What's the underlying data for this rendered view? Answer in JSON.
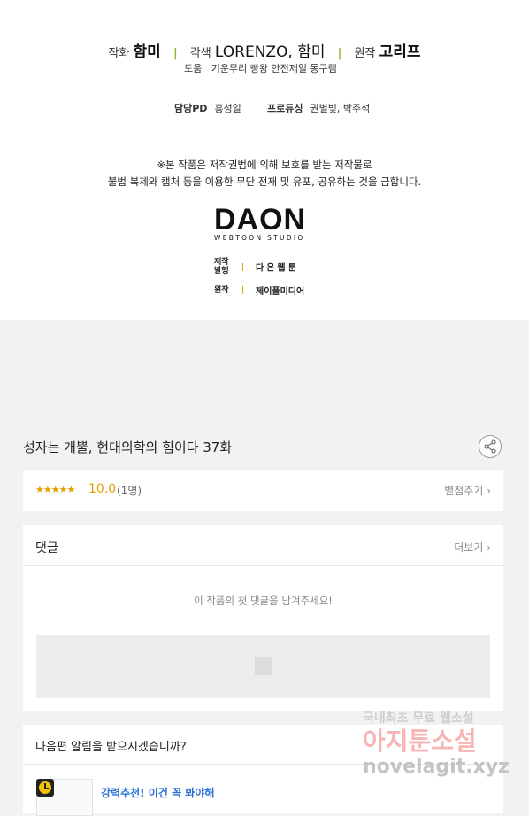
{
  "credits": {
    "art_label": "작화",
    "art_value": "함미",
    "color_label": "각색",
    "color_value": "LORENZO, 함미",
    "original_label": "원작",
    "original_value": "고리프",
    "sep": "|",
    "assist_label": "도움",
    "assist_value": "기운무리  빵왕  안전제일  동구램",
    "pd_label": "담당PD",
    "pd_value": "홍성일",
    "producing_label": "프로듀싱",
    "producing_value": "권별빛, 박주석",
    "notice_line1": "※본 작품은 저작권법에 의해 보호를 받는 저작물로",
    "notice_line2": "불법 복제와 캡처 등을 이용한 무단 전재 및 유포, 공유하는 것을 금합니다.",
    "logo_main": "DAON",
    "logo_sub": "WEBTOON STUDIO",
    "prod_label_1a": "제작",
    "prod_label_1b": "발행",
    "prod_value_1": "다온웹툰",
    "prod_label_2": "원작",
    "prod_value_2": "제이플미디어"
  },
  "episode": {
    "title": "성자는 개뿔, 현대의학의 힘이다 37화"
  },
  "rating": {
    "stars": "★★★★★",
    "score": "10.0",
    "count": "(1명)",
    "rate_button": "별점주기 ›"
  },
  "comments": {
    "header": "댓글",
    "more": "더보기 ›",
    "empty_text": "이 작품의 첫 댓글을 남겨주세요!"
  },
  "alert": {
    "question": "다음편 알림을 받으시겠습니까?",
    "recommend": "강력추천! 이건 꼭 봐야해"
  },
  "watermark": {
    "line1": "국내최초 무료 웹소설",
    "line2": "아지툰소설",
    "line3": "novelagit.xyz"
  },
  "colors": {
    "accent_star": "#e5a100",
    "link_blue": "#2a6fd6",
    "separator_green": "#8cb83a"
  }
}
